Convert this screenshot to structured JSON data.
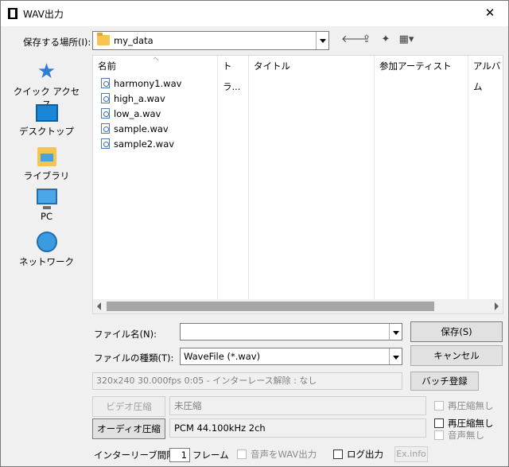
{
  "window": {
    "title": "WAV出力",
    "close": "✕"
  },
  "location": {
    "label": "保存する場所(I):",
    "value": "my_data"
  },
  "toolbar": {
    "back": "🡐",
    "up": "⇪",
    "newfolder": "✦",
    "view": "▦▾"
  },
  "places": [
    {
      "label": "クイック アクセス"
    },
    {
      "label": "デスクトップ"
    },
    {
      "label": "ライブラリ"
    },
    {
      "label": "PC"
    },
    {
      "label": "ネットワーク"
    }
  ],
  "columns": [
    "名前",
    "トラ...",
    "タイトル",
    "参加アーティスト",
    "アルバム"
  ],
  "files": [
    "harmony1.wav",
    "high_a.wav",
    "low_a.wav",
    "sample.wav",
    "sample2.wav"
  ],
  "form": {
    "filename_label": "ファイル名(N):",
    "filename_value": "",
    "filetype_label": "ファイルの種類(T):",
    "filetype_value": "WaveFile (*.wav)",
    "save_button": "保存(S)",
    "cancel_button": "キャンセル",
    "batch_button": "バッチ登録",
    "info": "320x240  30.000fps  0:05  -  インターレース解除 : なし",
    "video_button": "ビデオ圧縮",
    "video_value": "未圧縮",
    "video_recompress": "再圧縮無し",
    "audio_button": "オーディオ圧縮",
    "audio_value": "PCM 44.100kHz 2ch",
    "audio_recompress": "再圧縮無し",
    "audio_none": "音声無し",
    "interleave_label": "インターリーブ間隔 :",
    "interleave_value": "1",
    "interleave_unit": "フレーム",
    "audio_to_wav": "音声をWAV出力",
    "log_output": "ログ出力",
    "exinfo_button": "Ex.info"
  }
}
